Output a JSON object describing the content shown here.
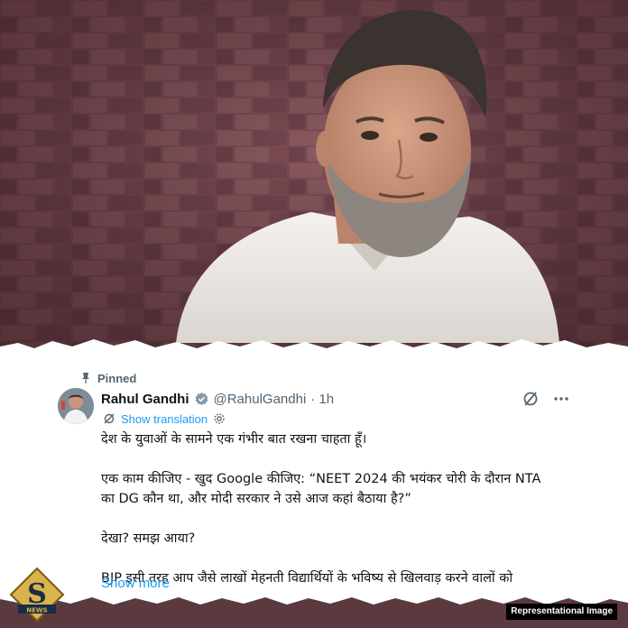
{
  "post": {
    "pinned_label": "Pinned",
    "author_name": "Rahul Gandhi",
    "author_handle": "@RahulGandhi",
    "time_ago": "· 1h",
    "show_translation": "Show translation",
    "body_lines": [
      "देश के युवाओं के सामने एक गंभीर बात रखना चाहता हूँ।",
      "एक काम कीजिए - खुद Google कीजिए: “NEET 2024 की भयंकर चोरी के दौरान NTA",
      "का DG कौन था, और मोदी सरकार ने उसे आज कहां बैठाया है?”",
      "देखा? समझ आया?",
      "BJP इसी तरह आप जैसे लाखों मेहनती विद्यार्थियों के भविष्य से खिलवाड़ करने वालों को"
    ],
    "show_more": "Show more"
  },
  "logo": {
    "letter": "S",
    "caption": "NEWS"
  },
  "overlay_label": "Representational Image",
  "icons": [
    "pin-icon",
    "verified-icon",
    "grok-icon",
    "more-icon",
    "translate-icon",
    "settings-icon"
  ],
  "colors": {
    "link": "#1d9bf0",
    "text": "#0f1419",
    "muted": "#536471",
    "brick": "#7a4a52",
    "logo_gold": "#d9b44a"
  }
}
